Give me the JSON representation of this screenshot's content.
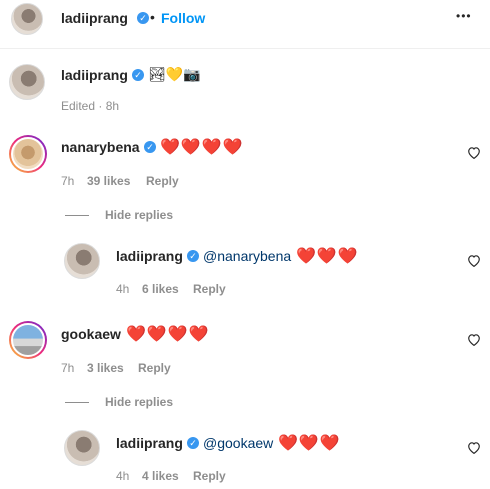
{
  "header": {
    "username": "ladiiprang",
    "separator": "•",
    "follow_label": "Follow",
    "more_glyph": "•••"
  },
  "caption": {
    "username": "ladiiprang",
    "emojis": "🏞💛📷",
    "meta": "Edited · 8h"
  },
  "comments": [
    {
      "username": "nanarybena",
      "text": "❤️❤️❤️❤️",
      "time": "7h",
      "likes": "39 likes",
      "reply": "Reply",
      "hide_replies": "Hide replies",
      "replies": [
        {
          "username": "ladiiprang",
          "mention": "@nanarybena",
          "text": "❤️❤️❤️",
          "time": "4h",
          "likes": "6 likes",
          "reply": "Reply"
        }
      ]
    },
    {
      "username": "gookaew",
      "text": "❤️❤️❤️❤️",
      "time": "7h",
      "likes": "3 likes",
      "reply": "Reply",
      "hide_replies": "Hide replies",
      "replies": [
        {
          "username": "ladiiprang",
          "mention": "@gookaew",
          "text": "❤️❤️❤️",
          "time": "4h",
          "likes": "4 likes",
          "reply": "Reply"
        }
      ]
    }
  ],
  "colors": {
    "follow": "#0095f6",
    "verified": "#3897f0",
    "meta": "#8e8e8e",
    "heart": "#e0423b"
  }
}
